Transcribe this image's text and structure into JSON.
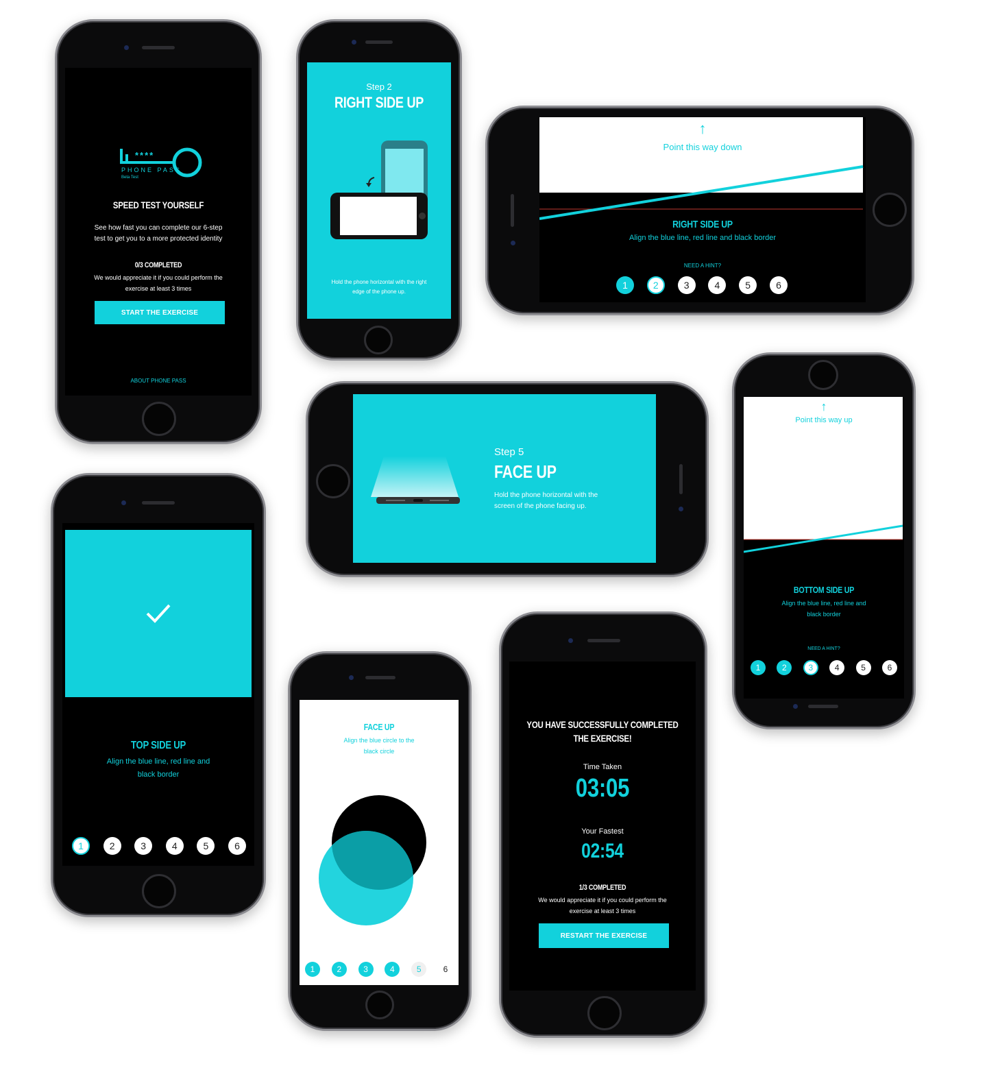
{
  "colors": {
    "accent": "#12d1dc",
    "screen_bg": "#000000",
    "background": "#ffffff"
  },
  "start": {
    "logo_stars": "****",
    "logo_name": "PHONE PASS",
    "logo_sub": "Beta Test",
    "title": "SPEED TEST YOURSELF",
    "desc_line1": "See how fast you can complete our 6-step",
    "desc_line2": "test to get you to a more protected identity",
    "progress": "0/3 COMPLETED",
    "note_line1": "We would appreciate it if you could perform the",
    "note_line2": "exercise at least 3 times",
    "button": "START THE EXERCISE",
    "about": "ABOUT PHONE PASS"
  },
  "step2": {
    "step": "Step 2",
    "title": "RIGHT SIDE UP",
    "hint_line1": "Hold the phone horizontal with the right",
    "hint_line2": "edge of the phone up."
  },
  "rightside": {
    "point": "Point this way down",
    "title": "RIGHT SIDE UP",
    "desc": "Align the blue line, red line and black border",
    "hint": "NEED A HINT?",
    "steps": [
      "1",
      "2",
      "3",
      "4",
      "5",
      "6"
    ]
  },
  "step5": {
    "step": "Step 5",
    "title": "FACE UP",
    "hint_line1": "Hold the phone horizontal with the",
    "hint_line2": "screen of the phone facing up."
  },
  "bottomside": {
    "point": "Point this way up",
    "title": "BOTTOM SIDE UP",
    "desc_line1": "Align the blue line, red line and",
    "desc_line2": "black border",
    "hint": "NEED A HINT?",
    "steps": [
      "1",
      "2",
      "3",
      "4",
      "5",
      "6"
    ]
  },
  "topside": {
    "check_icon": "check-icon",
    "title": "TOP SIDE UP",
    "desc_line1": "Align the blue line, red line and",
    "desc_line2": "black border",
    "steps": [
      "1",
      "2",
      "3",
      "4",
      "5",
      "6"
    ]
  },
  "faceup": {
    "title": "FACE UP",
    "desc_line1": "Align the blue circle to the",
    "desc_line2": "black circle",
    "steps": [
      "1",
      "2",
      "3",
      "4",
      "5",
      "6"
    ]
  },
  "done": {
    "title_line1": "YOU HAVE SUCCESSFULLY COMPLETED",
    "title_line2": "THE EXERCISE!",
    "time_label": "Time Taken",
    "time": "03:05",
    "fastest_label": "Your Fastest",
    "fastest": "02:54",
    "progress": "1/3 COMPLETED",
    "note_line1": "We would appreciate it if you could perform the",
    "note_line2": "exercise at least 3 times",
    "button": "RESTART THE EXERCISE"
  }
}
